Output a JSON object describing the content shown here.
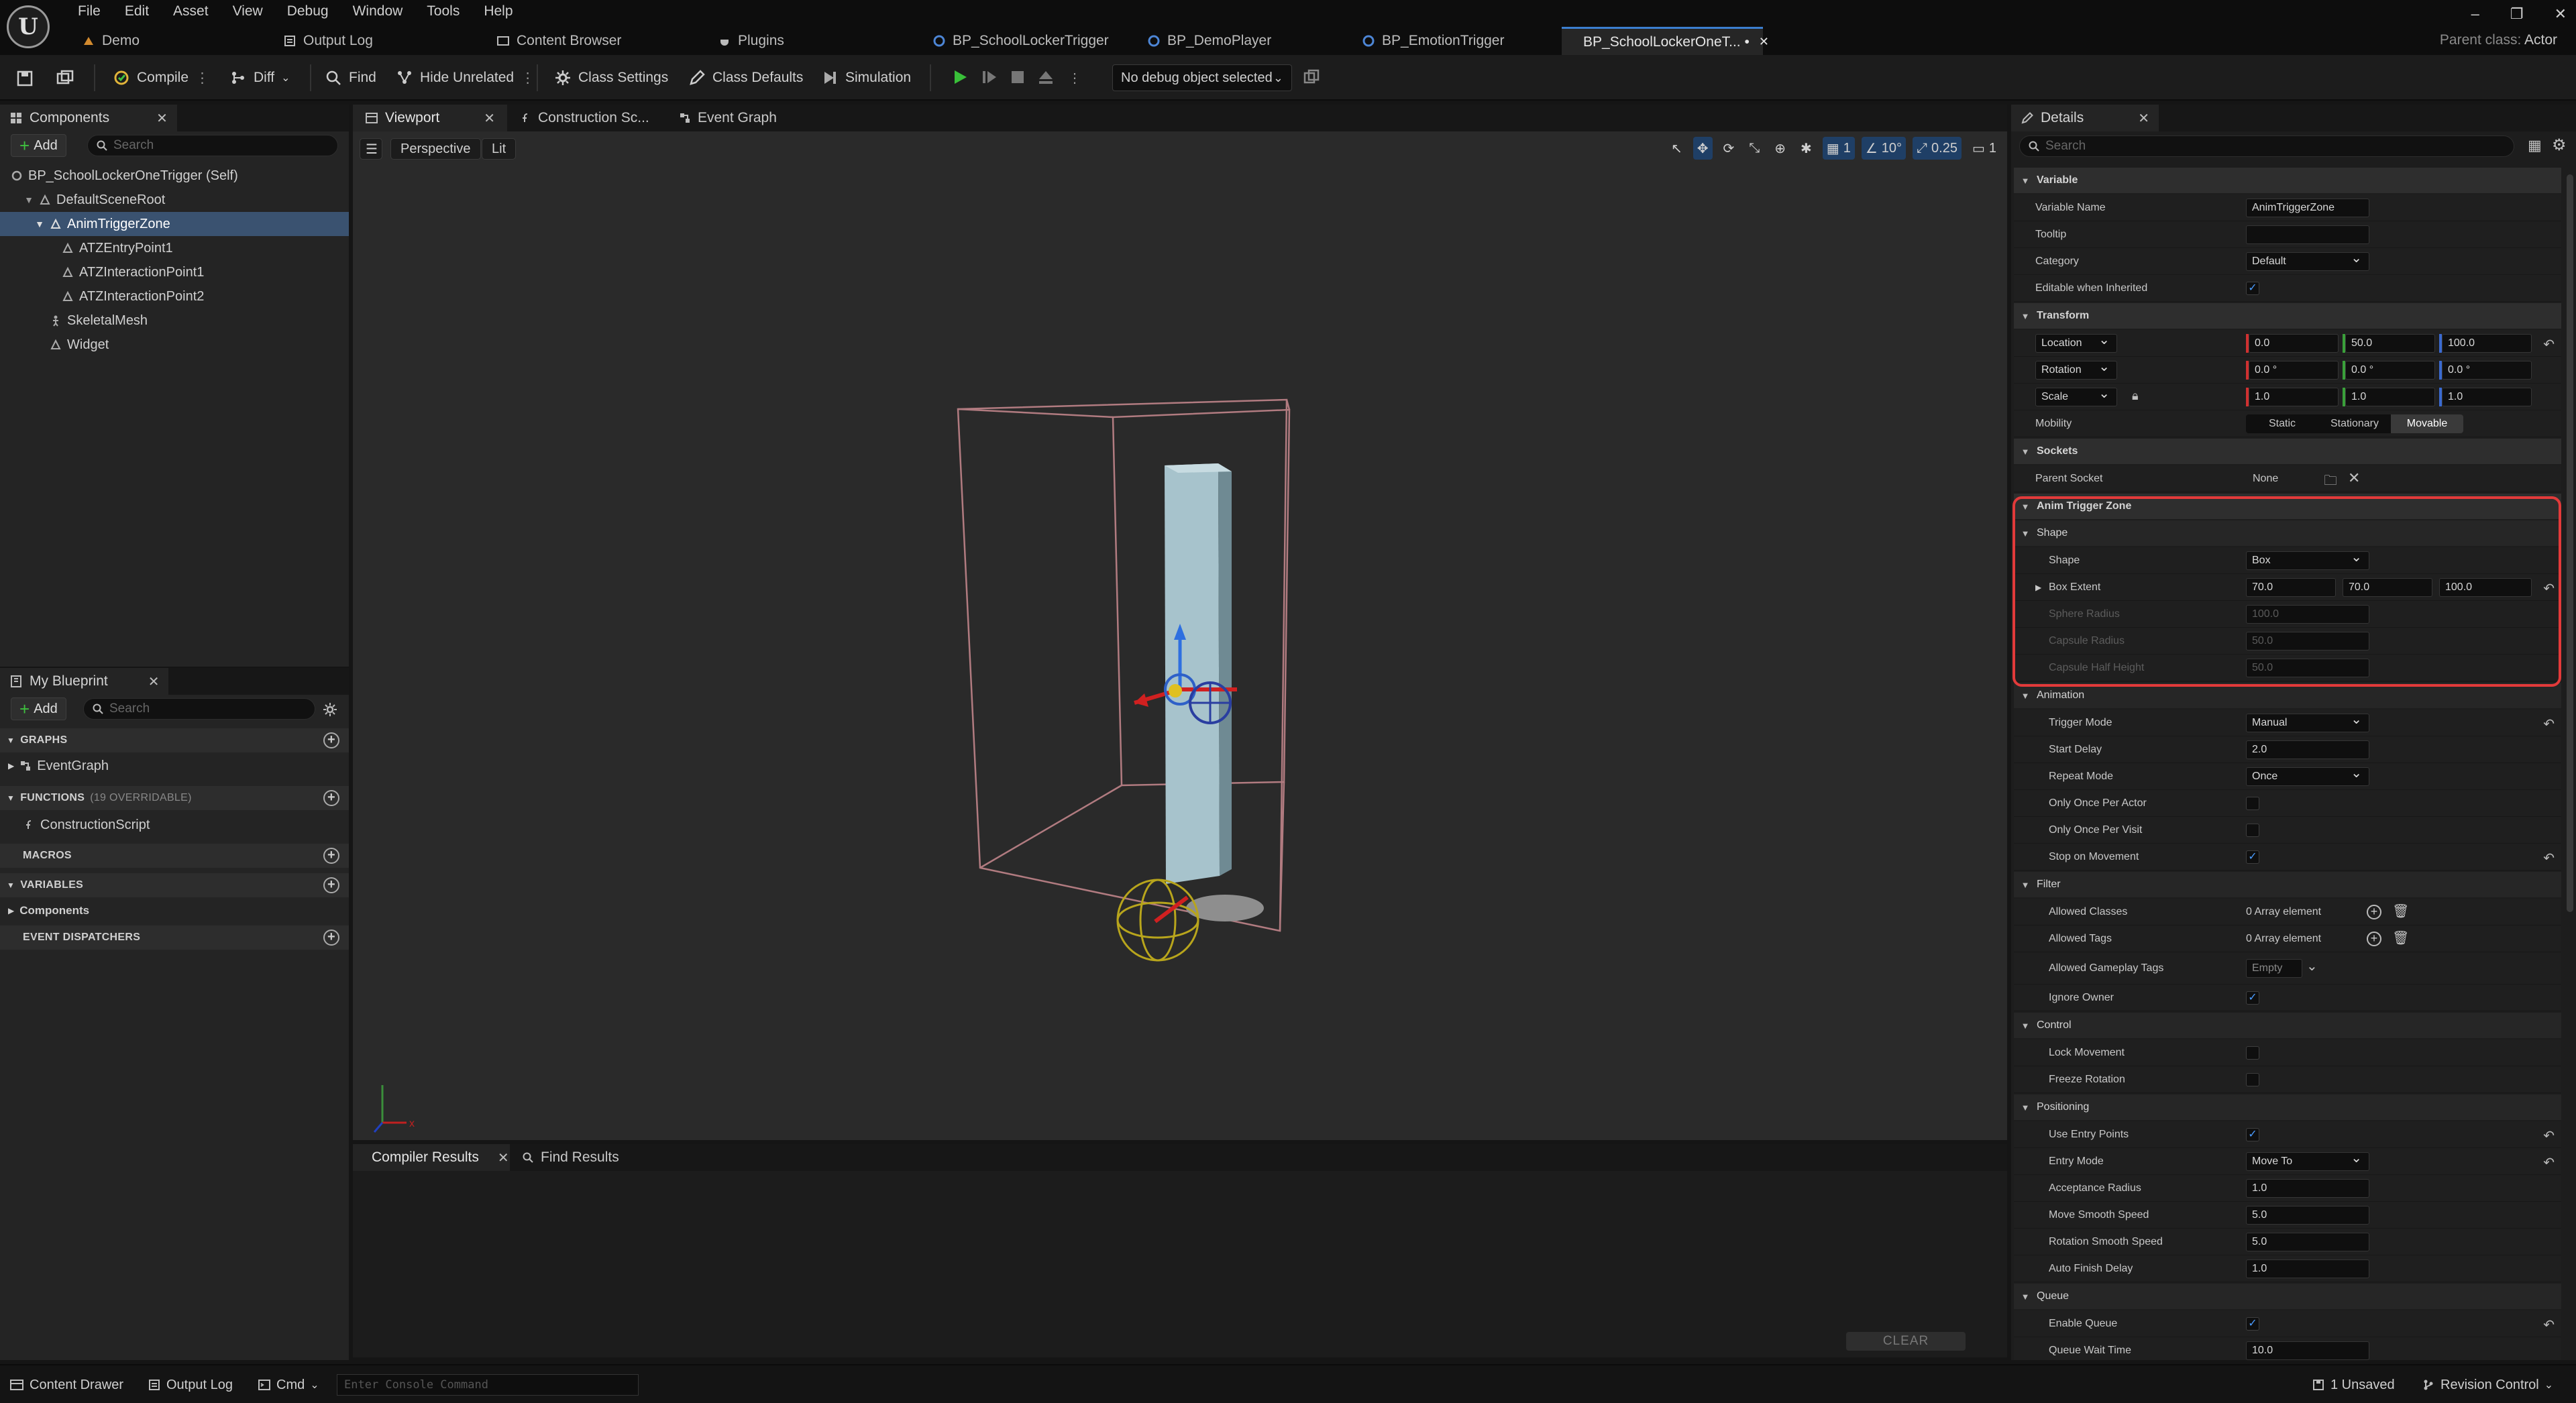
{
  "menu": [
    "File",
    "Edit",
    "Asset",
    "View",
    "Debug",
    "Window",
    "Tools",
    "Help"
  ],
  "doc_tabs": [
    {
      "label": "Demo",
      "icon": "level-icon"
    },
    {
      "label": "Output Log",
      "icon": "log-icon"
    },
    {
      "label": "Content Browser",
      "icon": "browser-icon"
    },
    {
      "label": "Plugins",
      "icon": "plug-icon"
    },
    {
      "label": "BP_SchoolLockerTrigger",
      "icon": "blueprint-icon"
    },
    {
      "label": "BP_DemoPlayer",
      "icon": "blueprint-icon"
    },
    {
      "label": "BP_EmotionTrigger",
      "icon": "blueprint-icon"
    },
    {
      "label": "BP_SchoolLockerOneT... •",
      "icon": "blueprint-icon",
      "active": true
    }
  ],
  "parent_class": {
    "label": "Parent class:",
    "value": "Actor"
  },
  "window_controls": [
    "–",
    "❐",
    "✕"
  ],
  "toolbar": {
    "compile": "Compile",
    "diff": "Diff",
    "find": "Find",
    "hide_unrelated": "Hide Unrelated",
    "class_settings": "Class Settings",
    "class_defaults": "Class Defaults",
    "simulation": "Simulation",
    "debug_object": "No debug object selected"
  },
  "components_panel": {
    "tab": "Components",
    "add": "Add",
    "search_placeholder": "Search",
    "tree": [
      {
        "label": "BP_SchoolLockerOneTrigger (Self)",
        "indent": 0
      },
      {
        "label": "DefaultSceneRoot",
        "indent": 1,
        "expanded": true
      },
      {
        "label": "AnimTriggerZone",
        "indent": 2,
        "expanded": true,
        "selected": true
      },
      {
        "label": "ATZEntryPoint1",
        "indent": 3
      },
      {
        "label": "ATZInteractionPoint1",
        "indent": 3
      },
      {
        "label": "ATZInteractionPoint2",
        "indent": 3
      },
      {
        "label": "SkeletalMesh",
        "indent": 2
      },
      {
        "label": "Widget",
        "indent": 2
      }
    ]
  },
  "blueprint_panel": {
    "tab": "My Blueprint",
    "add": "Add",
    "search_placeholder": "Search",
    "graphs": "GRAPHS",
    "event_graph": "EventGraph",
    "functions": "FUNCTIONS",
    "functions_note": "(19 OVERRIDABLE)",
    "construction_script": "ConstructionScript",
    "macros": "MACROS",
    "variables": "VARIABLES",
    "components": "Components",
    "dispatchers": "EVENT DISPATCHERS"
  },
  "viewport": {
    "tabs": [
      "Viewport",
      "Construction Sc...",
      "Event Graph"
    ],
    "perspective": "Perspective",
    "lit": "Lit",
    "grid": "1",
    "angle": "10°",
    "scale": "0.25",
    "camera": "1"
  },
  "compiler": {
    "tabs": [
      "Compiler Results",
      "Find Results"
    ],
    "clear": "CLEAR"
  },
  "details": {
    "tab": "Details",
    "search_placeholder": "Search",
    "variable": {
      "title": "Variable",
      "name_label": "Variable Name",
      "name": "AnimTriggerZone",
      "tooltip_label": "Tooltip",
      "tooltip": "",
      "category_label": "Category",
      "category": "Default",
      "editable_label": "Editable when Inherited"
    },
    "transform": {
      "title": "Transform",
      "location_label": "Location",
      "location": [
        "0.0",
        "50.0",
        "100.0"
      ],
      "rotation_label": "Rotation",
      "rotation": [
        "0.0 °",
        "0.0 °",
        "0.0 °"
      ],
      "scale_label": "Scale",
      "scale": [
        "1.0",
        "1.0",
        "1.0"
      ],
      "mobility_label": "Mobility",
      "mobility": [
        "Static",
        "Stationary",
        "Movable"
      ]
    },
    "sockets": {
      "title": "Sockets",
      "parent_label": "Parent Socket",
      "parent": "None"
    },
    "atz": {
      "title": "Anim Trigger Zone",
      "shape_title": "Shape",
      "shape_label": "Shape",
      "shape": "Box",
      "box_label": "Box Extent",
      "box": [
        "70.0",
        "70.0",
        "100.0"
      ],
      "sphere_label": "Sphere Radius",
      "sphere": "100.0",
      "caps_r_label": "Capsule Radius",
      "caps_r": "50.0",
      "caps_h_label": "Capsule Half Height",
      "caps_h": "50.0"
    },
    "animation": {
      "title": "Animation",
      "trigger_label": "Trigger Mode",
      "trigger": "Manual",
      "delay_label": "Start Delay",
      "delay": "2.0",
      "repeat_label": "Repeat Mode",
      "repeat": "Once",
      "once_actor": "Only Once Per Actor",
      "once_visit": "Only Once Per Visit",
      "stop_move": "Stop on Movement"
    },
    "filter": {
      "title": "Filter",
      "classes_label": "Allowed Classes",
      "classes": "0 Array element",
      "tags_label": "Allowed Tags",
      "tags": "0 Array element",
      "gtags_label": "Allowed Gameplay Tags",
      "gtags": "Empty",
      "ignore_label": "Ignore Owner"
    },
    "control": {
      "title": "Control",
      "lock": "Lock Movement",
      "freeze": "Freeze Rotation"
    },
    "positioning": {
      "title": "Positioning",
      "entry_points": "Use Entry Points",
      "entry_mode_label": "Entry Mode",
      "entry_mode": "Move To",
      "accept_label": "Acceptance Radius",
      "accept": "1.0",
      "move_label": "Move Smooth Speed",
      "move": "5.0",
      "rot_label": "Rotation Smooth Speed",
      "rot": "5.0",
      "finish_label": "Auto Finish Delay",
      "finish": "1.0"
    },
    "queue": {
      "title": "Queue",
      "enable": "Enable Queue",
      "wait_label": "Queue Wait Time",
      "wait": "10.0"
    }
  },
  "statusbar": {
    "content_drawer": "Content Drawer",
    "output_log": "Output Log",
    "cmd": "Cmd",
    "console_placeholder": "Enter Console Command",
    "unsaved": "1 Unsaved",
    "revision": "Revision Control"
  }
}
